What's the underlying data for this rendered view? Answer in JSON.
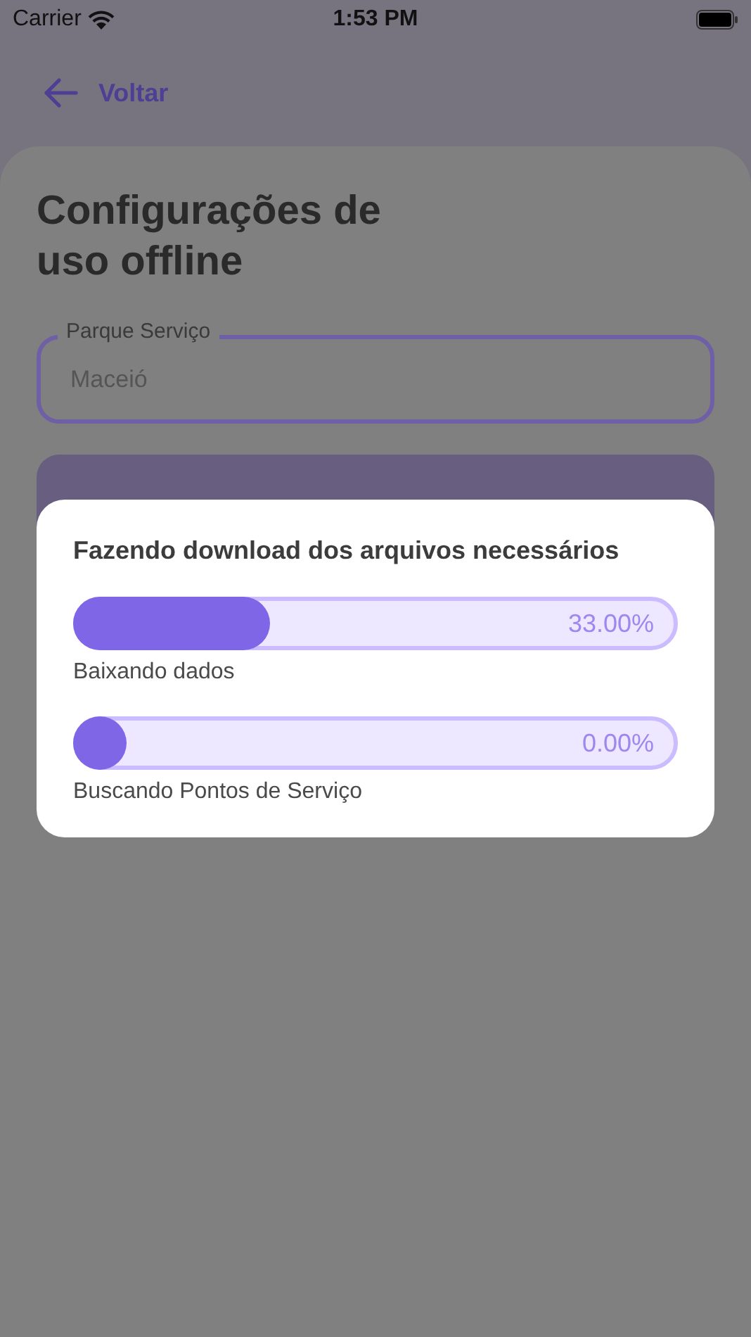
{
  "status_bar": {
    "carrier": "Carrier",
    "time": "1:53 PM"
  },
  "nav": {
    "back_label": "Voltar"
  },
  "title": "Configurações de uso offline",
  "field": {
    "label": "Parque Serviço",
    "value": "Maceió"
  },
  "dialog": {
    "title": "Fazendo download dos arquivos necessários",
    "tasks": [
      {
        "label": "Baixando dados",
        "reading": "33.00%",
        "level": 0.33
      },
      {
        "label": "Buscando Pontos de Serviço",
        "reading": "0.00%",
        "level": 0
      }
    ]
  }
}
